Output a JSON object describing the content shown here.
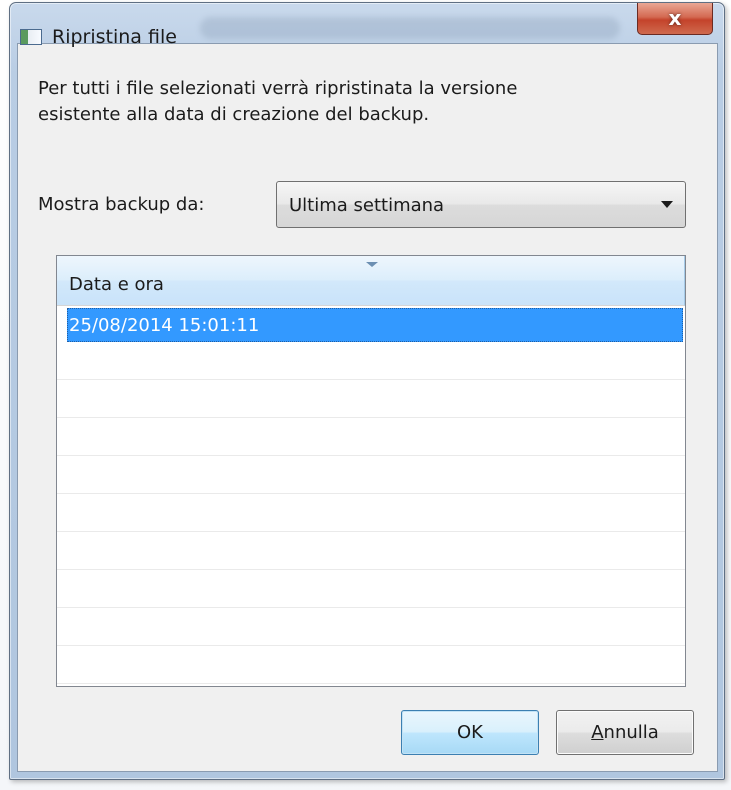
{
  "window": {
    "title": "Ripristina file",
    "close_glyph": "x"
  },
  "description": {
    "line1": "Per tutti i file selezionati verrà ripristinata la versione",
    "line2": "esistente alla data di creazione del backup."
  },
  "filter": {
    "label": "Mostra backup da:",
    "selected": "Ultima settimana"
  },
  "list": {
    "column_header": "Data e ora",
    "rows": [
      "25/08/2014 15:01:11"
    ]
  },
  "buttons": {
    "ok_label": "OK",
    "cancel_accel": "A",
    "cancel_rest": "nnulla"
  },
  "colors": {
    "selection": "#3399ff",
    "close_button": "#c4432b",
    "window_frame": "#b9cde4"
  },
  "icons": {
    "app": "app-window-icon",
    "close": "close-icon",
    "dropdown": "chevron-down-icon",
    "sort": "sort-indicator-icon"
  }
}
